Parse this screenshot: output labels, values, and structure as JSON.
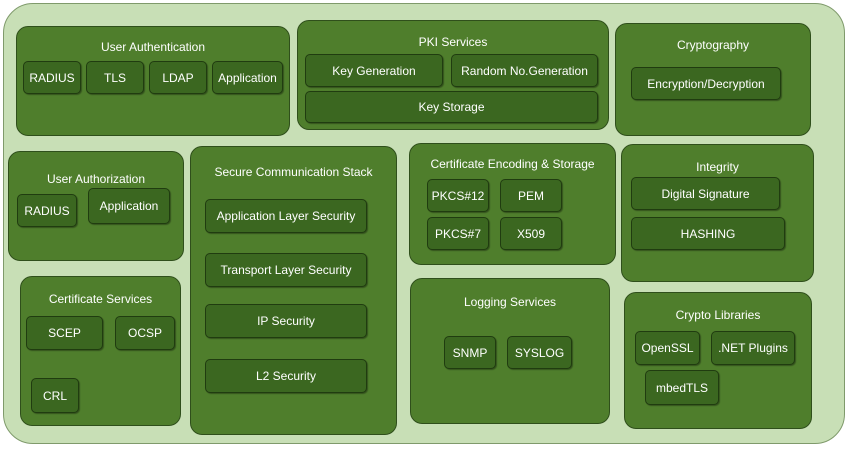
{
  "user_authentication": {
    "title": "User Authentication",
    "items": [
      "RADIUS",
      "TLS",
      "LDAP",
      "Application"
    ]
  },
  "pki_services": {
    "title": "PKI Services",
    "items": [
      "Key Generation",
      "Random No.Generation",
      "Key Storage"
    ]
  },
  "cryptography": {
    "title": "Cryptography",
    "items": [
      "Encryption/Decryption"
    ]
  },
  "user_authorization": {
    "title": "User Authorization",
    "items": [
      "RADIUS",
      "Application"
    ]
  },
  "secure_communication_stack": {
    "title": "Secure Communication Stack",
    "items": [
      "Application Layer Security",
      "Transport Layer Security",
      "IP Security",
      "L2 Security"
    ]
  },
  "certificate_encoding_storage": {
    "title": "Certificate Encoding & Storage",
    "items": [
      "PKCS#12",
      "PEM",
      "PKCS#7",
      "X509"
    ]
  },
  "integrity": {
    "title": "Integrity",
    "items": [
      "Digital Signature",
      "HASHING"
    ]
  },
  "certificate_services": {
    "title": "Certificate Services",
    "items": [
      "SCEP",
      "OCSP",
      "CRL"
    ]
  },
  "logging_services": {
    "title": "Logging Services",
    "items": [
      "SNMP",
      "SYSLOG"
    ]
  },
  "crypto_libraries": {
    "title": "Crypto Libraries",
    "items": [
      "OpenSSL",
      ".NET Plugins",
      "mbedTLS"
    ]
  }
}
